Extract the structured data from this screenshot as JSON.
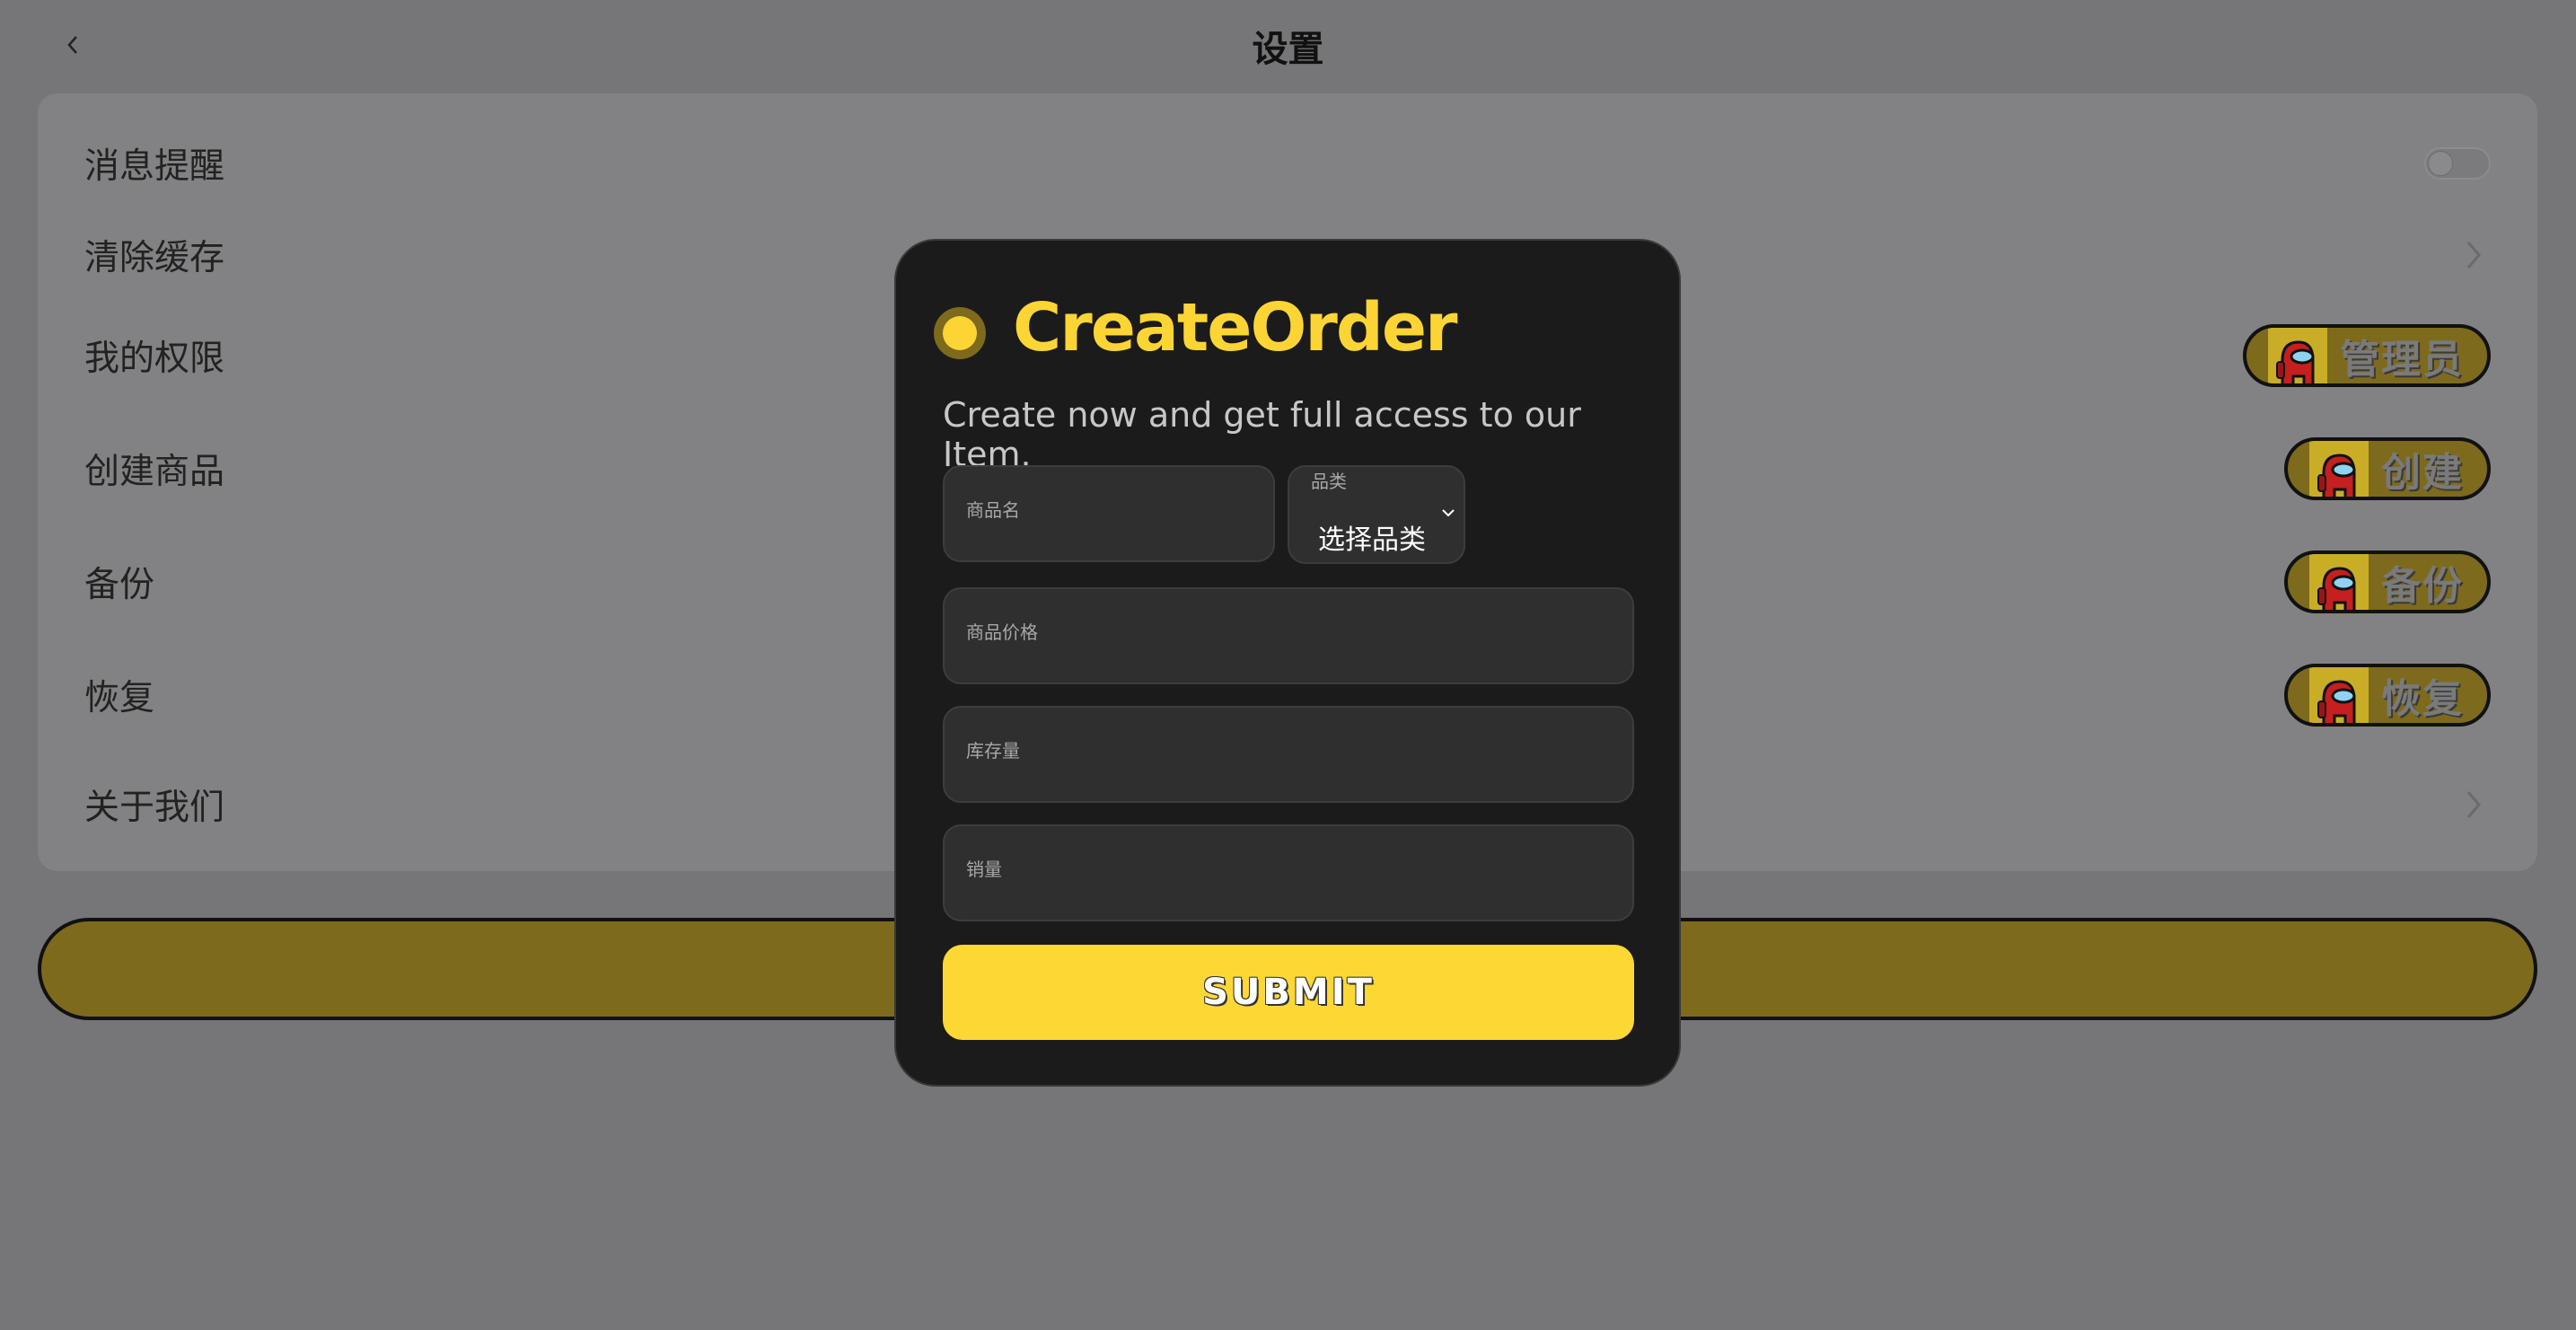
{
  "header": {
    "title": "设置",
    "back_icon": "chevron-left-icon"
  },
  "settings": {
    "rows": [
      {
        "label": "消息提醒",
        "control": "toggle",
        "toggle_on": false
      },
      {
        "label": "清除缓存",
        "control": "chevron"
      },
      {
        "label": "我的权限",
        "control": "pill",
        "pill_label": "管理员"
      },
      {
        "label": "创建商品",
        "control": "pill",
        "pill_label": "创建"
      },
      {
        "label": "备份",
        "control": "pill",
        "pill_label": "备份"
      },
      {
        "label": "恢复",
        "control": "pill",
        "pill_label": "恢复"
      },
      {
        "label": "关于我们",
        "control": "chevron"
      }
    ]
  },
  "modal": {
    "title": "CreateOrder",
    "subtitle": "Create now and get full access to our Item.",
    "fields": {
      "name": {
        "label": "商品名"
      },
      "category": {
        "label": "品类",
        "value": "选择品类"
      },
      "price": {
        "label": "商品价格"
      },
      "stock": {
        "label": "库存量"
      },
      "sales": {
        "label": "销量"
      }
    },
    "submit_label": "SUBMIT"
  },
  "colors": {
    "accent": "#fcd535",
    "accent_dim": "#7d6a1c",
    "modal_bg": "#1b1b1b",
    "overlay_bg": "#767678"
  }
}
